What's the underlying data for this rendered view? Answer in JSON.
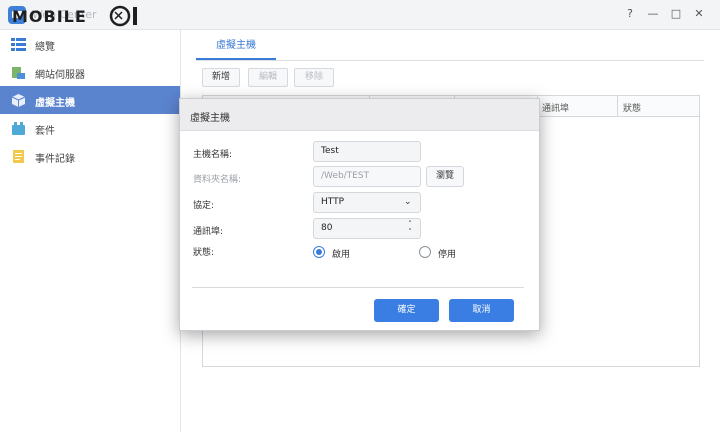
{
  "window": {
    "title": "Web Center",
    "watermark": "MOBILE01",
    "controls": {
      "help": "?",
      "minimize": "—",
      "maximize": "□",
      "close": "✕"
    }
  },
  "sidebar": {
    "items": [
      {
        "label": "總覽",
        "icon": "overview-icon",
        "active": false
      },
      {
        "label": "網站伺服器",
        "icon": "web-server-icon",
        "active": false
      },
      {
        "label": "虛擬主機",
        "icon": "virtual-host-icon",
        "active": true
      },
      {
        "label": "套件",
        "icon": "package-icon",
        "active": false
      },
      {
        "label": "事件記錄",
        "icon": "log-icon",
        "active": false
      }
    ]
  },
  "main": {
    "tab": "虛擬主機",
    "toolbar": {
      "create": "新增",
      "edit": "編輯",
      "remove": "移除"
    },
    "columns": [
      "通訊埠",
      "狀態"
    ]
  },
  "dialog": {
    "title": "虛擬主機",
    "fields": {
      "hostname_label": "主機名稱:",
      "hostname_value": "Test",
      "folder_label": "資料夾名稱:",
      "folder_value": "/Web/TEST",
      "browse_label": "瀏覽",
      "protocol_label": "協定:",
      "protocol_value": "HTTP",
      "port_label": "通訊埠:",
      "port_value": "80",
      "status_label": "狀態:",
      "status_enable": "啟用",
      "status_disable": "停用",
      "status_selected": "啟用"
    },
    "buttons": {
      "ok": "確定",
      "cancel": "取消"
    }
  },
  "colors": {
    "accent": "#3a7bd5",
    "sidebar_active": "#5b84cf",
    "primary_button": "#3a7ee4"
  }
}
